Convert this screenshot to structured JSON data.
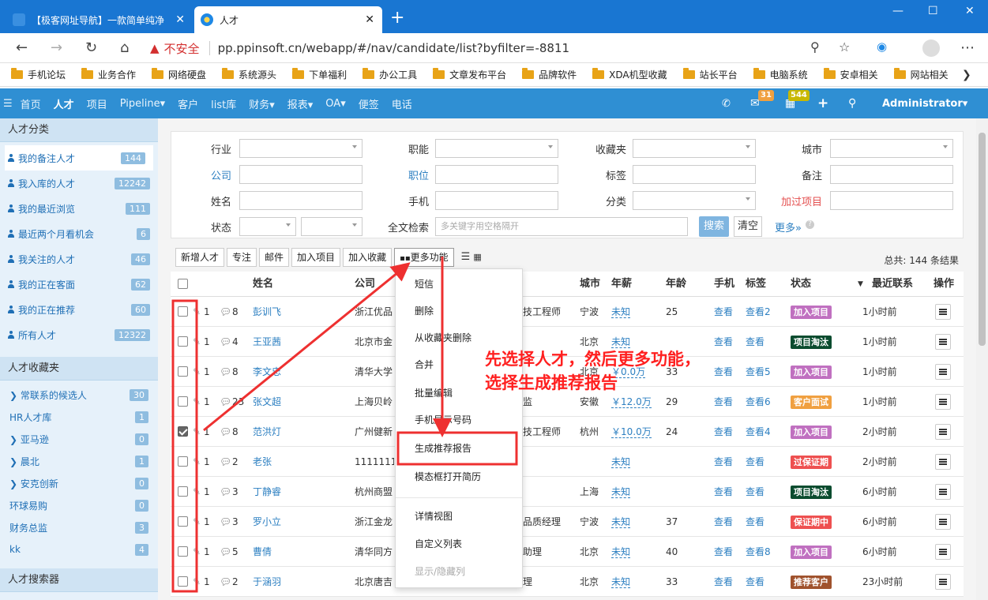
{
  "browser": {
    "tabs": [
      {
        "title": "【极客网址导航】一款简单纯净"
      },
      {
        "title": "人才"
      }
    ],
    "new_tab": "+",
    "insecure": "不安全",
    "url": "pp.ppinsoft.cn/webapp/#/nav/candidate/list?byfilter=-8811",
    "window_controls": [
      "—",
      "☐",
      "✕"
    ]
  },
  "bookmarks": [
    "手机论坛",
    "业务合作",
    "网络硬盘",
    "系统源头",
    "下单福利",
    "办公工具",
    "文章发布平台",
    "品牌软件",
    "XDA机型收藏",
    "站长平台",
    "电脑系统",
    "安卓相关",
    "网站相关"
  ],
  "appnav": {
    "menu": [
      "首页",
      "人才",
      "项目",
      "Pipeline▾",
      "客户",
      "list库",
      "财务▾",
      "报表▾",
      "OA▾",
      "便签",
      "电话"
    ],
    "mail_count": "31",
    "task_count": "544",
    "user": "Administrator▾"
  },
  "sidebar": {
    "section1": "人才分类",
    "categories": [
      {
        "label": "我的备注人才",
        "count": "144"
      },
      {
        "label": "我入库的人才",
        "count": "12242"
      },
      {
        "label": "我的最近浏览",
        "count": "111"
      },
      {
        "label": "最近两个月看机会",
        "count": "6"
      },
      {
        "label": "我关注的人才",
        "count": "46"
      },
      {
        "label": "我的正在客面",
        "count": "62"
      },
      {
        "label": "我的正在推荐",
        "count": "60"
      },
      {
        "label": "所有人才",
        "count": "12322"
      }
    ],
    "section2": "人才收藏夹",
    "folders": [
      {
        "label": "❯ 常联系的候选人",
        "count": "30"
      },
      {
        "label": "HR人才库",
        "count": "1"
      },
      {
        "label": "❯ 亚马逊",
        "count": "0"
      },
      {
        "label": "❯ 晨北",
        "count": "1"
      },
      {
        "label": "❯ 安克创新",
        "count": "0"
      },
      {
        "label": "环球易购",
        "count": "0"
      },
      {
        "label": "财务总监",
        "count": "3"
      },
      {
        "label": "kk",
        "count": "4"
      }
    ],
    "section3": "人才搜索器"
  },
  "filters": {
    "industry": "行业",
    "position": "职能",
    "favorite": "收藏夹",
    "city": "城市",
    "company": "公司",
    "job": "职位",
    "tag": "标签",
    "note": "备注",
    "name": "姓名",
    "phone": "手机",
    "category": "分类",
    "added_project": "加过项目",
    "status": "状态",
    "fulltext": "全文检索",
    "fulltext_placeholder": "多关键字用空格隔开",
    "search_btn": "搜索",
    "clear_btn": "清空",
    "more": "更多»"
  },
  "toolbar": {
    "buttons": [
      "新增人才",
      "专注",
      "邮件",
      "加入项目",
      "加入收藏"
    ],
    "more": "更多功能",
    "total": "总共: 144 条结果"
  },
  "table": {
    "headers": {
      "name": "姓名",
      "company": "公司",
      "city": "城市",
      "salary": "年薪",
      "age": "年龄",
      "phone": "手机",
      "tag": "标签",
      "status": "状态",
      "last": "最近联系",
      "op": "操作"
    },
    "rows": [
      {
        "checked": false,
        "a": "1",
        "c": "8",
        "name": "彭训飞",
        "company": "浙江优品",
        "title": "技工程师",
        "city": "宁波",
        "salary": "未知",
        "age": "25",
        "phone": "查看",
        "tag": "查看2",
        "status": "加入项目",
        "color": "#c070c0",
        "last": "1小时前"
      },
      {
        "checked": false,
        "a": "1",
        "c": "4",
        "name": "王亚茜",
        "company": "北京市金",
        "title": "",
        "city": "北京",
        "salary": "未知",
        "age": "",
        "phone": "查看",
        "tag": "查看",
        "status": "项目淘汰",
        "color": "#0b4c2f",
        "last": "1小时前"
      },
      {
        "checked": false,
        "a": "1",
        "c": "8",
        "name": "李文忠",
        "company": "清华大学",
        "title": "",
        "city": "北京",
        "salary": "￥0.0万",
        "age": "33",
        "phone": "查看",
        "tag": "查看5",
        "status": "加入项目",
        "color": "#c070c0",
        "last": "1小时前"
      },
      {
        "checked": false,
        "a": "1",
        "c": "23",
        "name": "张文超",
        "company": "上海贝岭",
        "title": "监",
        "city": "安徽",
        "salary": "￥12.0万",
        "age": "29",
        "phone": "查看",
        "tag": "查看6",
        "status": "客户面试",
        "color": "#f0a040",
        "last": "1小时前"
      },
      {
        "checked": true,
        "a": "1",
        "c": "8",
        "name": "范洪灯",
        "company": "广州健新",
        "title": "技工程师",
        "city": "杭州",
        "salary": "￥10.0万",
        "age": "24",
        "phone": "查看",
        "tag": "查看4",
        "status": "加入项目",
        "color": "#c070c0",
        "last": "2小时前"
      },
      {
        "checked": false,
        "a": "1",
        "c": "2",
        "name": "老张",
        "company": "11111111",
        "title": "",
        "city": "",
        "salary": "未知",
        "age": "",
        "phone": "查看",
        "tag": "查看",
        "status": "过保证期",
        "color": "#ee5050",
        "last": "2小时前"
      },
      {
        "checked": false,
        "a": "1",
        "c": "3",
        "name": "丁静睿",
        "company": "杭州商盟",
        "title": "",
        "city": "上海",
        "salary": "未知",
        "age": "",
        "phone": "查看",
        "tag": "查看",
        "status": "项目淘汰",
        "color": "#0b4c2f",
        "last": "6小时前"
      },
      {
        "checked": false,
        "a": "1",
        "c": "3",
        "name": "罗小立",
        "company": "浙江金龙",
        "title": "品质经理",
        "city": "宁波",
        "salary": "未知",
        "age": "37",
        "phone": "查看",
        "tag": "查看",
        "status": "保证期中",
        "color": "#ee5050",
        "last": "6小时前"
      },
      {
        "checked": false,
        "a": "1",
        "c": "5",
        "name": "曹倩",
        "company": "清华同方",
        "title": "助理",
        "city": "北京",
        "salary": "未知",
        "age": "40",
        "phone": "查看",
        "tag": "查看8",
        "status": "加入项目",
        "color": "#c070c0",
        "last": "6小时前"
      },
      {
        "checked": false,
        "a": "1",
        "c": "2",
        "name": "于涵羽",
        "company": "北京唐吉",
        "title": "理",
        "city": "北京",
        "salary": "未知",
        "age": "33",
        "phone": "查看",
        "tag": "查看",
        "status": "推荐客户",
        "color": "#a0522d",
        "last": "23小时前"
      }
    ]
  },
  "menu": {
    "items": [
      "短信",
      "删除",
      "从收藏夹删除",
      "合并",
      "批量编辑",
      "手机显示号码",
      "生成推荐报告",
      "模态框打开简历",
      "详情视图",
      "自定义列表",
      "显示/隐藏列"
    ]
  },
  "annotation": "先选择人才，然后更多功能，选择生成推荐报告"
}
